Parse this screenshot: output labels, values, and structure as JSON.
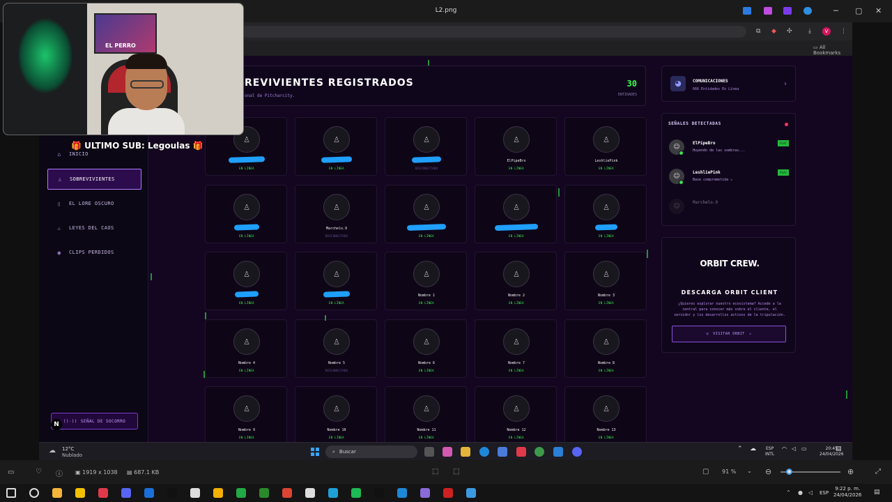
{
  "viewer": {
    "title": "L2.png",
    "dimensions": "1919 x 1038",
    "filesize": "687.1 KB",
    "zoom": "91 %"
  },
  "browser": {
    "all_bookmarks": "All Bookmarks",
    "profile_initial": "V"
  },
  "site": {
    "nav": [
      {
        "label": "INICIO",
        "icon": "home-icon",
        "active": false
      },
      {
        "label": "SOBREVIVIENTES",
        "icon": "group-icon",
        "active": true
      },
      {
        "label": "EL LORE OSCURO",
        "icon": "book-icon",
        "active": false
      },
      {
        "label": "LEYES DEL CAOS",
        "icon": "warning-icon",
        "active": false
      },
      {
        "label": "CLIPS PERDIDOS",
        "icon": "eye-icon",
        "active": false
      }
    ],
    "sos_label": "SEÑAL DE SOCORRO",
    "header": {
      "title": "REVIVIENTES REGISTRADOS",
      "subtitle": "onal de Pitcharcity.",
      "count": "30",
      "count_label": "ENTIDADES"
    },
    "survivors": [
      {
        "name": "",
        "status": "EN LÍNEA",
        "online": true
      },
      {
        "name": "",
        "status": "EN LÍNEA",
        "online": true
      },
      {
        "name": "",
        "status": "DESCONECTADO",
        "online": false
      },
      {
        "name": "ElPipeBro",
        "status": "EN LÍNEA",
        "online": true
      },
      {
        "name": "LeshliePink",
        "status": "EN LÍNEA",
        "online": true
      },
      {
        "name": "",
        "status": "EN LÍNEA",
        "online": true
      },
      {
        "name": "Marchelo.9",
        "status": "DESCONECTADO",
        "online": false
      },
      {
        "name": "",
        "status": "EN LÍNEA",
        "online": true
      },
      {
        "name": "",
        "status": "EN LÍNEA",
        "online": true
      },
      {
        "name": "",
        "status": "EN LÍNEA",
        "online": true
      },
      {
        "name": "",
        "status": "EN LÍNEA",
        "online": true
      },
      {
        "name": "",
        "status": "EN LÍNEA",
        "online": true
      },
      {
        "name": "Nombre 1",
        "status": "EN LÍNEA",
        "online": true
      },
      {
        "name": "Nombre 2",
        "status": "EN LÍNEA",
        "online": true
      },
      {
        "name": "Nombre 3",
        "status": "EN LÍNEA",
        "online": true
      },
      {
        "name": "Nombre 4",
        "status": "EN LÍNEA",
        "online": true
      },
      {
        "name": "Nombre 5",
        "status": "DESCONECTADO",
        "online": false
      },
      {
        "name": "Nombre 6",
        "status": "EN LÍNEA",
        "online": true
      },
      {
        "name": "Nombre 7",
        "status": "EN LÍNEA",
        "online": true
      },
      {
        "name": "Nombre 8",
        "status": "EN LÍNEA",
        "online": true
      },
      {
        "name": "Nombre 9",
        "status": "EN LÍNEA",
        "online": true
      },
      {
        "name": "Nombre 10",
        "status": "EN LÍNEA",
        "online": true
      },
      {
        "name": "Nombre 11",
        "status": "EN LÍNEA",
        "online": true
      },
      {
        "name": "Nombre 12",
        "status": "EN LÍNEA",
        "online": true
      },
      {
        "name": "Nombre 13",
        "status": "EN LÍNEA",
        "online": true
      }
    ],
    "comms": {
      "title": "COMUNICACIONES",
      "subtitle": "666 Entidades En Línea"
    },
    "signals": {
      "title": "SEÑALES DETECTADAS",
      "rows": [
        {
          "name": "ElPipeBro",
          "message": "Huyendo de las sombras...",
          "tag": "PLAY"
        },
        {
          "name": "LeshliePink",
          "message": "Base comprometida ⚠",
          "tag": "PLAY"
        },
        {
          "name": "Marchelo.9",
          "message": "",
          "tag": ""
        }
      ]
    },
    "orbit": {
      "logo": "ORBIT CREW.",
      "heading": "DESCARGA ORBIT CLIENT",
      "text": "¿Quieres explorar nuestro ecosistema? Accede a la central para conocer más sobre el cliente, el servidor y los desarrollos activos de la tripulación.",
      "button": "VISITAR ORBIT"
    }
  },
  "windows_taskbar": {
    "temp": "12°C",
    "weather": "Nublado",
    "search_placeholder": "Buscar",
    "lang1": "ESP",
    "lang2": "INTL",
    "time": "20:45",
    "date": "24/04/2026"
  },
  "stream": {
    "sub_label": "🎁 ULTIMO SUB: Legoulas 🎁",
    "poster_text": "EL PERRO"
  },
  "os": {
    "lang": "ESP",
    "time": "9:22 p. m.",
    "date": "24/04/2026"
  },
  "colors": {
    "accent": "#b07cff",
    "online": "#39ff4f",
    "bg": "#140620"
  }
}
